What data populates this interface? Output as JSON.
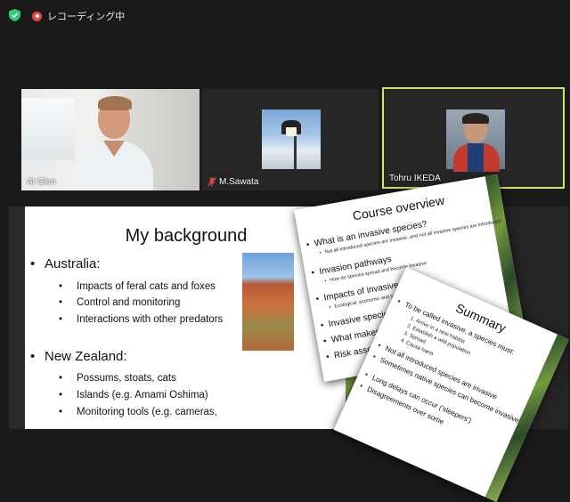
{
  "topbar": {
    "recording_label": "レコーディング中"
  },
  "participants": [
    {
      "name": "Al Glen",
      "active_speaker": false,
      "muted": false
    },
    {
      "name": "M.Sawata",
      "active_speaker": false,
      "muted": true
    },
    {
      "name": "Tohru IKEDA",
      "active_speaker": true,
      "muted": false
    }
  ],
  "colors": {
    "active_border": "#d7e35a",
    "recording": "#e5483f",
    "secure": "#2ecc71"
  },
  "slide": {
    "title": "My background",
    "sections": [
      {
        "heading": "Australia:",
        "items": [
          "Impacts of feral cats and foxes",
          "Control and monitoring",
          "Interactions with other predators"
        ]
      },
      {
        "heading": "New Zealand:",
        "items": [
          "Possums, stoats, cats",
          "Islands (e.g. Amami Oshima)",
          "Monitoring tools (e.g. cameras,"
        ]
      }
    ]
  },
  "overview_card": {
    "title": "Course overview",
    "items": [
      {
        "text": "What is an invasive species?",
        "sub": "Not all introduced species are invasive, and not all invasive species are introduced"
      },
      {
        "text": "Invasion pathways",
        "sub": "How do species spread and become invasive"
      },
      {
        "text": "Impacts of invasive species",
        "sub": "Ecological, economic and social"
      },
      {
        "text": "Invasive species on",
        "sub": ""
      },
      {
        "text": "What makes a su",
        "sub": ""
      },
      {
        "text": "Risk assessme",
        "sub": ""
      }
    ]
  },
  "summary_card": {
    "title": "Summary",
    "lead": "To be called invasive, a species must:",
    "numbered": [
      "Arrive in a new habitat",
      "Establish a wild population",
      "Spread",
      "Cause harm"
    ],
    "points": [
      "Not all introduced species are invasive",
      "Sometimes native species can become invasive",
      "Long delays can occur ('sleepers')",
      "Disagreements over some"
    ]
  }
}
